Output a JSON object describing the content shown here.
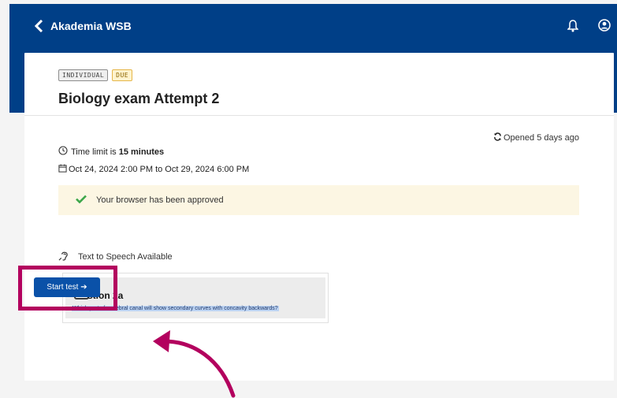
{
  "header": {
    "title": "Akademia WSB",
    "back_icon": "chevron-left-icon",
    "bell_icon": "bell-icon",
    "user_icon": "user-circle-icon"
  },
  "assignment": {
    "badges": [
      "INDIVIDUAL",
      "DUE"
    ],
    "title": "Biology exam Attempt 2",
    "opened": "Opened 5 days ago",
    "time_limit_prefix": "Time limit is ",
    "time_limit_value": "15 minutes",
    "date_range": "Oct 24, 2024 2:00 PM to Oct 29, 2024 6:00 PM",
    "approval_message": "Your browser has been approved",
    "tts_label": "Text to Speech Available"
  },
  "question_preview": {
    "title": "stion 2a",
    "text": "Which part of vertebral canal will show secondary curves with concavity backwards?"
  },
  "actions": {
    "start_label": "Start test ➔"
  },
  "colors": {
    "header_bg": "#003f87",
    "button_bg": "#0a51a8",
    "highlight": "#b3005e",
    "approval_bg": "#fcf6e3",
    "check": "#3ca64a"
  }
}
